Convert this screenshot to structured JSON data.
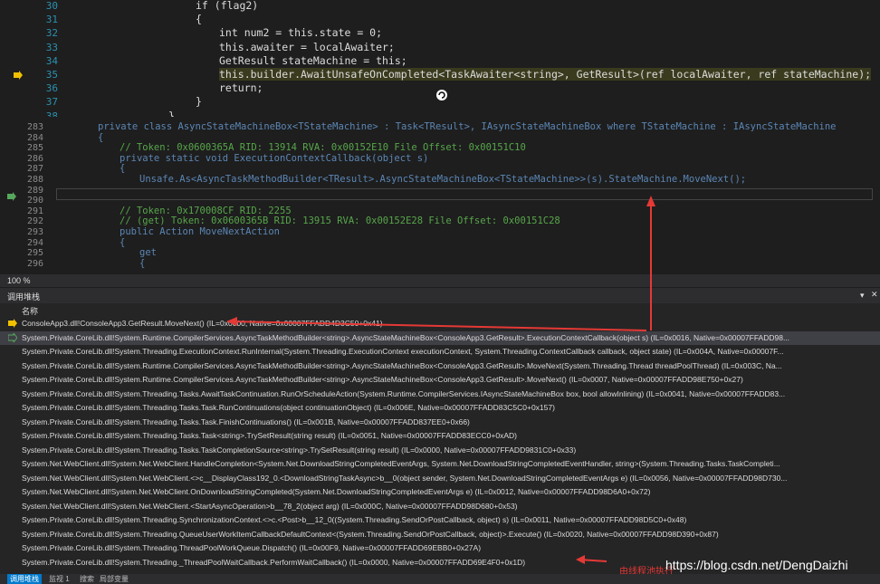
{
  "top_editor": {
    "lines": [
      {
        "n": "30",
        "text": "if (flag2)"
      },
      {
        "n": "31",
        "text": "{"
      },
      {
        "n": "32",
        "text": "int num2 = this.state = 0;"
      },
      {
        "n": "33",
        "text": "this.awaiter = localAwaiter;"
      },
      {
        "n": "34",
        "text": "GetResult stateMachine = this;"
      },
      {
        "n": "35",
        "text": "this.builder.AwaitUnsafeOnCompleted<TaskAwaiter<string>, GetResult>(ref localAwaiter, ref stateMachine);"
      },
      {
        "n": "36",
        "text": "return;"
      },
      {
        "n": "37",
        "text": "}"
      },
      {
        "n": "38",
        "text": "}"
      }
    ]
  },
  "mid_editor": {
    "lines": [
      {
        "n": "283",
        "text": "private class AsyncStateMachineBox<TStateMachine> : Task<TResult>, IAsyncStateMachineBox where TStateMachine : IAsyncStateMachine"
      },
      {
        "n": "284",
        "text": "{"
      },
      {
        "n": "285",
        "text": "// Token: 0x0600365A RID: 13914 RVA: 0x00152E10 File Offset: 0x00151C10"
      },
      {
        "n": "286",
        "text": "private static void ExecutionContextCallback(object s)"
      },
      {
        "n": "287",
        "text": "{"
      },
      {
        "n": "288",
        "text": "Unsafe.As<AsyncTaskMethodBuilder<TResult>.AsyncStateMachineBox<TStateMachine>>(s).StateMachine.MoveNext();"
      },
      {
        "n": "289",
        "text": ""
      },
      {
        "n": "290",
        "text": ""
      },
      {
        "n": "291",
        "text": "// Token: 0x170008CF RID: 2255"
      },
      {
        "n": "292",
        "text": "// (get) Token: 0x0600365B RID: 13915 RVA: 0x00152E28 File Offset: 0x00151C28"
      },
      {
        "n": "293",
        "text": "public Action MoveNextAction"
      },
      {
        "n": "294",
        "text": "{"
      },
      {
        "n": "295",
        "text": "get"
      },
      {
        "n": "296",
        "text": "{"
      }
    ]
  },
  "zoom_label": "100 %",
  "call_stack": {
    "title": "调用堆栈",
    "column": "名称",
    "rows": [
      "ConsoleApp3.dll!ConsoleApp3.GetResult.MoveNext() (IL=0x0000, Native=0x00007FFADD4D3C50+0x41)",
      "System.Private.CoreLib.dll!System.Runtime.CompilerServices.AsyncTaskMethodBuilder<string>.AsyncStateMachineBox<ConsoleApp3.GetResult>.ExecutionContextCallback(object s) (IL=0x0016, Native=0x00007FFADD98...",
      "System.Private.CoreLib.dll!System.Threading.ExecutionContext.RunInternal(System.Threading.ExecutionContext executionContext, System.Threading.ContextCallback callback, object state) (IL=0x004A, Native=0x00007F...",
      "System.Private.CoreLib.dll!System.Runtime.CompilerServices.AsyncTaskMethodBuilder<string>.AsyncStateMachineBox<ConsoleApp3.GetResult>.MoveNext(System.Threading.Thread threadPoolThread) (IL=0x003C, Na...",
      "System.Private.CoreLib.dll!System.Runtime.CompilerServices.AsyncTaskMethodBuilder<string>.AsyncStateMachineBox<ConsoleApp3.GetResult>.MoveNext() (IL=0x0007, Native=0x00007FFADD98E750+0x27)",
      "System.Private.CoreLib.dll!System.Threading.Tasks.AwaitTaskContinuation.RunOrScheduleAction(System.Runtime.CompilerServices.IAsyncStateMachineBox box, bool allowInlining) (IL=0x0041, Native=0x00007FFADD83...",
      "System.Private.CoreLib.dll!System.Threading.Tasks.Task.RunContinuations(object continuationObject) (IL=0x006E, Native=0x00007FFADD83C5C0+0x157)",
      "System.Private.CoreLib.dll!System.Threading.Tasks.Task.FinishContinuations() (IL=0x001B, Native=0x00007FFADD837EE0+0x66)",
      "System.Private.CoreLib.dll!System.Threading.Tasks.Task<string>.TrySetResult(string result) (IL=0x0051, Native=0x00007FFADD83ECC0+0xAD)",
      "System.Private.CoreLib.dll!System.Threading.Tasks.TaskCompletionSource<string>.TrySetResult(string result) (IL=0x0000, Native=0x00007FFADD9831C0+0x33)",
      "System.Net.WebClient.dll!System.Net.WebClient.HandleCompletion<System.Net.DownloadStringCompletedEventArgs, System.Net.DownloadStringCompletedEventHandler, string>(System.Threading.Tasks.TaskCompleti...",
      "System.Net.WebClient.dll!System.Net.WebClient.<>c__DisplayClass192_0.<DownloadStringTaskAsync>b__0(object sender, System.Net.DownloadStringCompletedEventArgs e) (IL=0x0056, Native=0x00007FFADD98D730...",
      "System.Net.WebClient.dll!System.Net.WebClient.OnDownloadStringCompleted(System.Net.DownloadStringCompletedEventArgs e) (IL=0x0012, Native=0x00007FFADD98D6A0+0x72)",
      "System.Net.WebClient.dll!System.Net.WebClient.<StartAsyncOperation>b__78_2(object arg) (IL=0x000C, Native=0x00007FFADD98D680+0x53)",
      "System.Private.CoreLib.dll!System.Threading.SynchronizationContext.<>c.<Post>b__12_0((System.Threading.SendOrPostCallback, object) s) (IL=0x0011, Native=0x00007FFADD98D5C0+0x48)",
      "System.Private.CoreLib.dll!System.Threading.QueueUserWorkItemCallbackDefaultContext<(System.Threading.SendOrPostCallback, object)>.Execute() (IL=0x0020, Native=0x00007FFADD98D390+0x87)",
      "System.Private.CoreLib.dll!System.Threading.ThreadPoolWorkQueue.Dispatch() (IL=0x00F9, Native=0x00007FFADD69EBB0+0x27A)",
      "System.Private.CoreLib.dll!System.Threading._ThreadPoolWaitCallback.PerformWaitCallback() (IL=0x0000, Native=0x00007FFADD69E4F0+0x1D)"
    ]
  },
  "tabs": [
    "调用堆栈",
    "监视 1",
    "搜索",
    "局部变量"
  ],
  "annotation_label": "由线程池执行",
  "watermark": "https://blog.csdn.net/DengDaizhi",
  "colors": {
    "accent": "#e53935",
    "selection": "#264f78"
  }
}
